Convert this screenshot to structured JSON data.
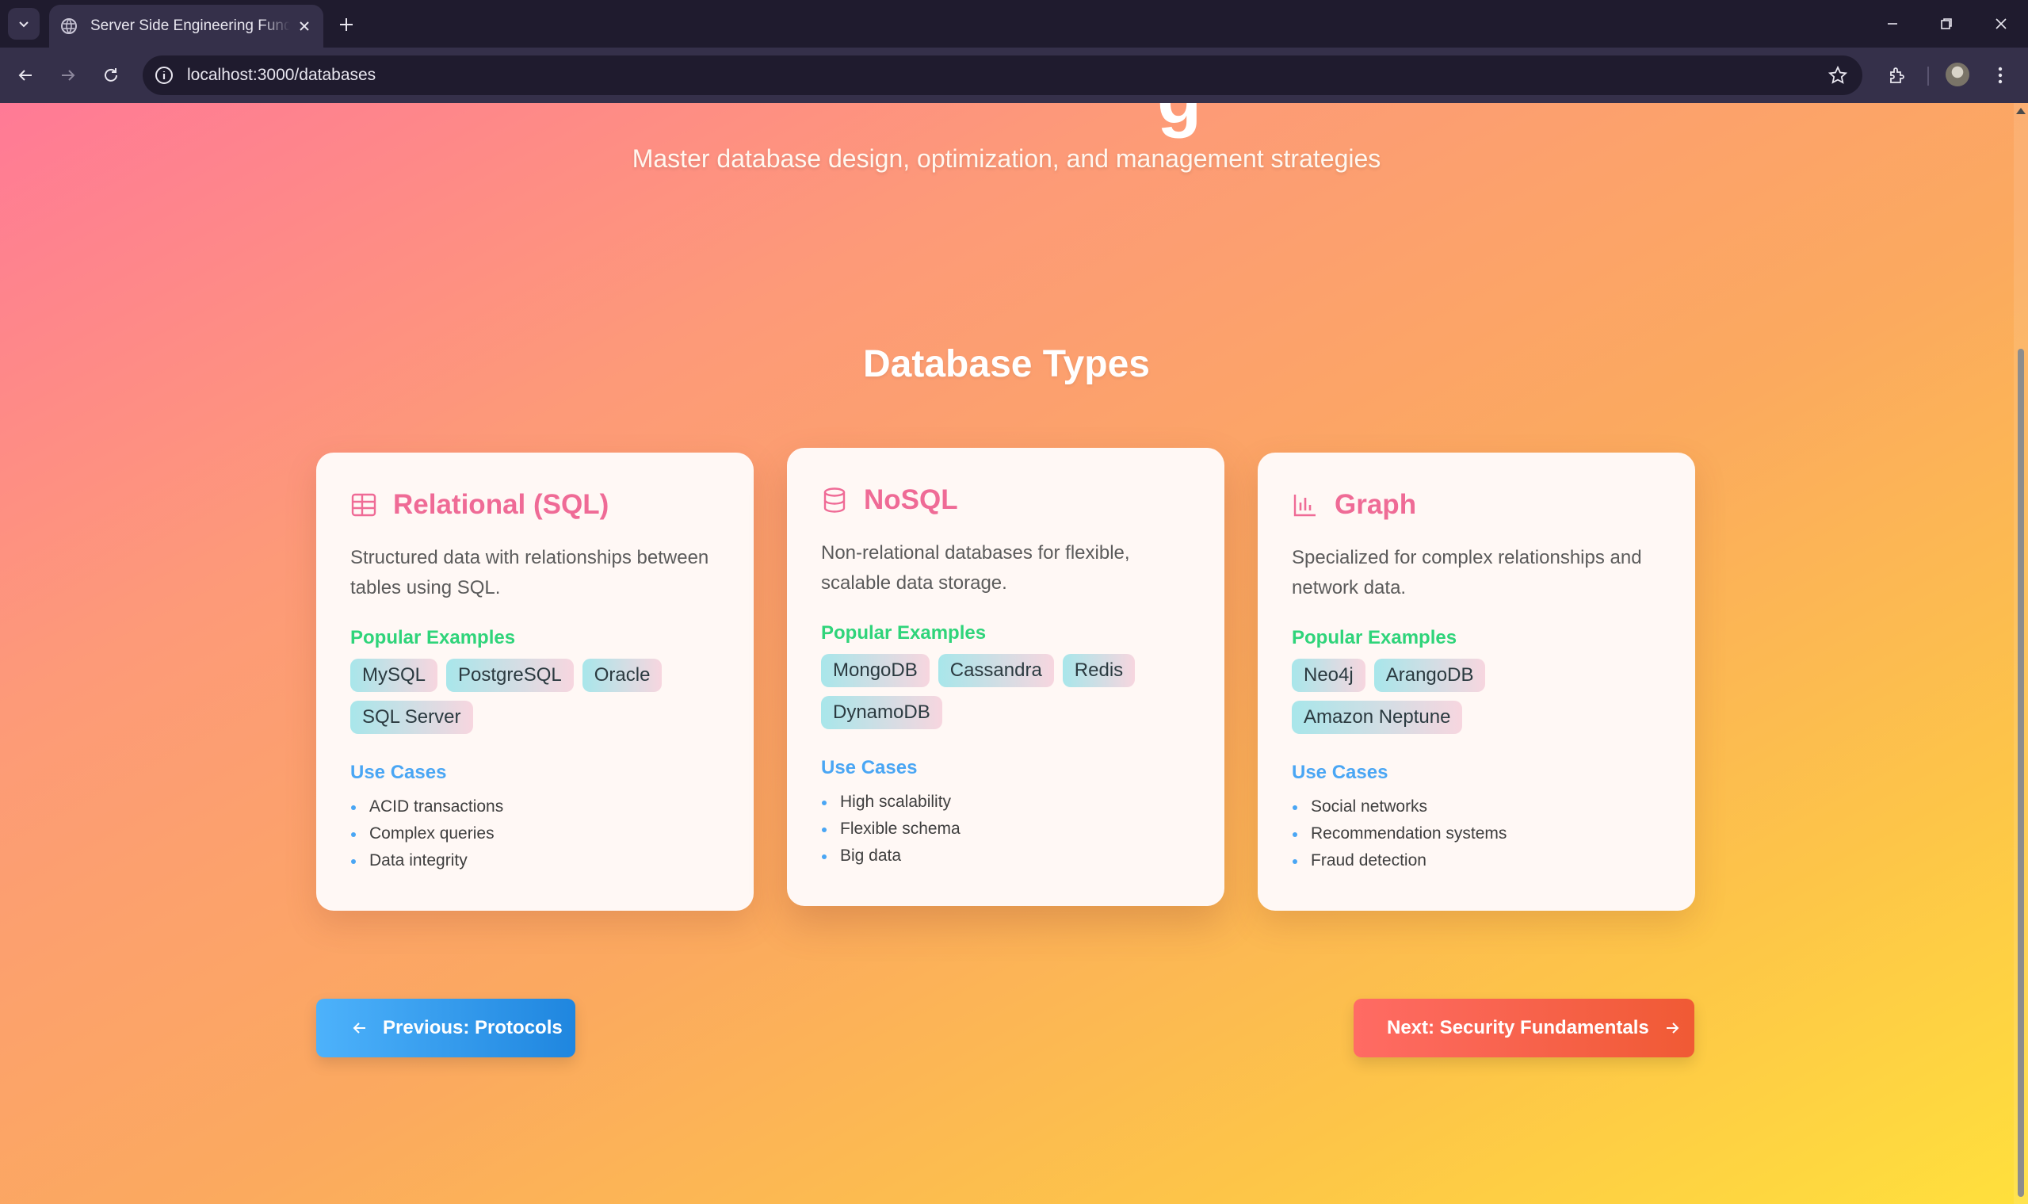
{
  "browser": {
    "tab_title": "Server Side Engineering Fundamentals",
    "url": "localhost:3000/databases",
    "icons": [
      "tab-search-icon",
      "globe-icon",
      "close-icon",
      "plus-icon",
      "minimize-icon",
      "restore-icon",
      "close-window-icon",
      "back-icon",
      "forward-icon",
      "reload-icon",
      "site-info-icon",
      "star-icon",
      "extensions-icon",
      "profile-avatar",
      "kebab-menu-icon"
    ]
  },
  "hero": {
    "title_fragment": "g",
    "subtitle": "Master database design, optimization, and management strategies"
  },
  "section": {
    "title": "Database Types"
  },
  "cards": [
    {
      "icon": "table-icon",
      "title": "Relational (SQL)",
      "description": "Structured data with relationships between tables using SQL.",
      "examples_heading": "Popular Examples",
      "examples": [
        "MySQL",
        "PostgreSQL",
        "Oracle",
        "SQL Server"
      ],
      "use_cases_heading": "Use Cases",
      "use_cases": [
        "ACID transactions",
        "Complex queries",
        "Data integrity"
      ]
    },
    {
      "icon": "database-icon",
      "title": "NoSQL",
      "description": "Non-relational databases for flexible, scalable data storage.",
      "examples_heading": "Popular Examples",
      "examples": [
        "MongoDB",
        "Cassandra",
        "Redis",
        "DynamoDB"
      ],
      "use_cases_heading": "Use Cases",
      "use_cases": [
        "High scalability",
        "Flexible schema",
        "Big data"
      ]
    },
    {
      "icon": "bar-chart-icon",
      "title": "Graph",
      "description": "Specialized for complex relationships and network data.",
      "examples_heading": "Popular Examples",
      "examples": [
        "Neo4j",
        "ArangoDB",
        "Amazon Neptune"
      ],
      "use_cases_heading": "Use Cases",
      "use_cases": [
        "Social networks",
        "Recommendation systems",
        "Fraud detection"
      ]
    }
  ],
  "navigation": {
    "prev_label": "Previous: Protocols",
    "next_label": "Next: Security Fundamentals"
  },
  "colors": {
    "card_title": "#ef6b96",
    "examples_heading": "#2fd47a",
    "use_cases_heading": "#4aa6f4",
    "prev_button": "#1f86df",
    "next_button": "#f05a34"
  }
}
